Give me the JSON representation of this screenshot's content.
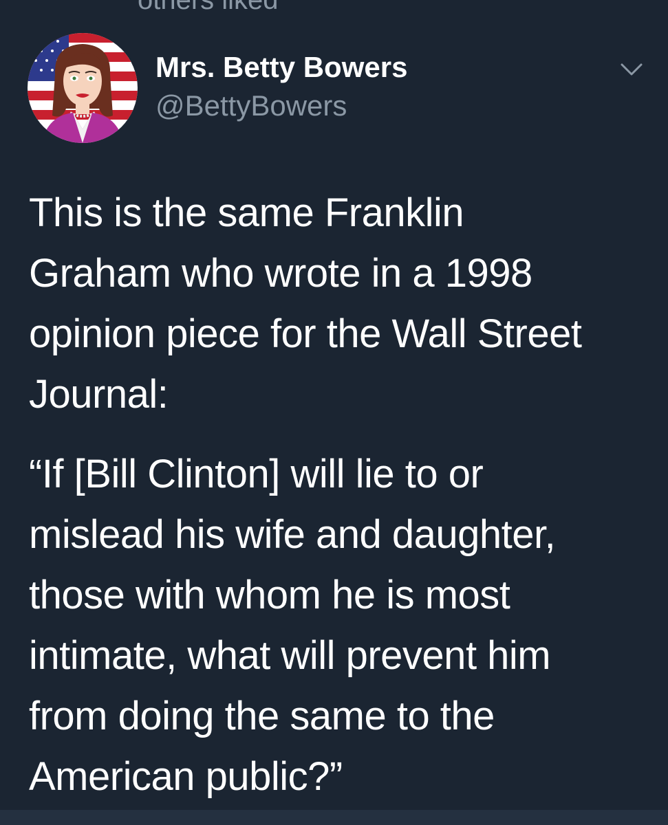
{
  "context": {
    "label": "others liked"
  },
  "tweet": {
    "author": {
      "display_name": "Mrs. Betty Bowers",
      "handle": "@BettyBowers",
      "avatar_icon": "illustrated-woman-flag-avatar"
    },
    "menu_icon": "chevron-down-icon",
    "text_lines": [
      "This is the same Franklin",
      "Graham who wrote in a 1998",
      "opinion piece for the Wall Street",
      "Journal:",
      "“If [Bill Clinton] will lie to or",
      "mislead his wife and daughter,",
      "those with whom he is most",
      "intimate, what will prevent him",
      "from doing the same to the",
      "American public?”"
    ]
  },
  "colors": {
    "background": "#1b2532",
    "text_primary": "#ffffff",
    "text_secondary": "#8b98a5"
  }
}
